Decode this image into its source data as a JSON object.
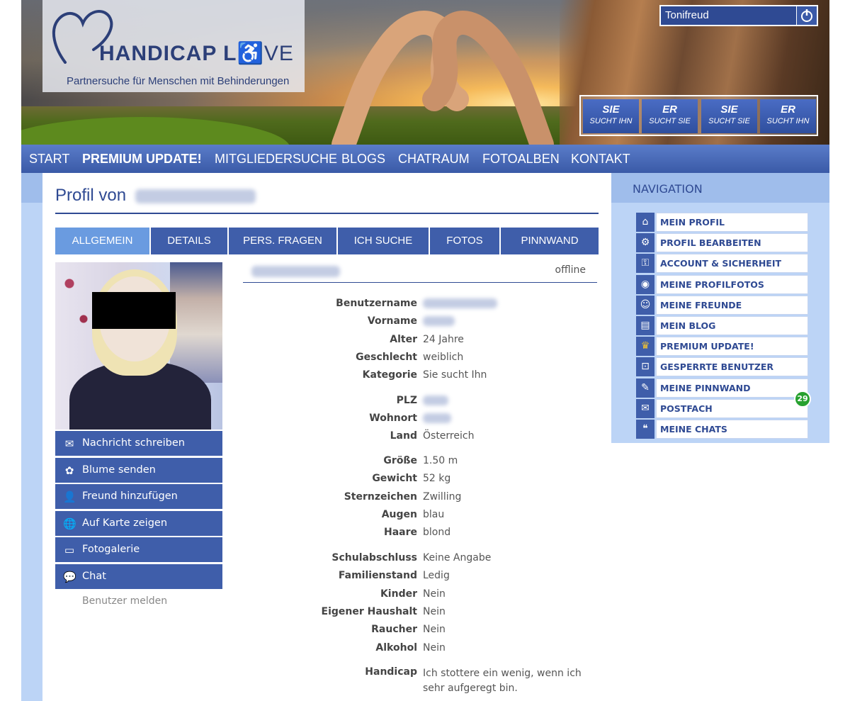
{
  "brand": {
    "name_bold": "HANDICAP L",
    "name_thin": "VE",
    "tagline": "Partnersuche für Menschen mit Behinderungen"
  },
  "user": {
    "username": "Tonifreud"
  },
  "quick_search": [
    {
      "line1": "SIE",
      "line2": "SUCHT IHN"
    },
    {
      "line1": "ER",
      "line2": "SUCHT SIE"
    },
    {
      "line1": "SIE",
      "line2": "SUCHT SIE"
    },
    {
      "line1": "ER",
      "line2": "SUCHT IHN"
    }
  ],
  "nav": [
    "START",
    "PREMIUM UPDATE!",
    "MITGLIEDERSUCHE",
    "BLOGS",
    "CHATRAUM",
    "FOTOALBEN",
    "KONTAKT"
  ],
  "profile": {
    "title_prefix": "Profil von",
    "status": "offline",
    "tabs": [
      "ALLGEMEIN",
      "DETAILS",
      "PERS. FRAGEN",
      "ICH SUCHE",
      "FOTOS",
      "PINNWAND"
    ],
    "actions": [
      "Nachricht schreiben",
      "Blume senden",
      "Freund hinzufügen",
      "Auf Karte zeigen",
      "Fotogalerie",
      "Chat"
    ],
    "report": "Benutzer melden",
    "fields": [
      {
        "k": "Benutzername",
        "v": ""
      },
      {
        "k": "Vorname",
        "v": ""
      },
      {
        "k": "Alter",
        "v": "24 Jahre"
      },
      {
        "k": "Geschlecht",
        "v": "weiblich"
      },
      {
        "k": "Kategorie",
        "v": "Sie sucht Ihn"
      },
      {
        "k": "PLZ",
        "v": ""
      },
      {
        "k": "Wohnort",
        "v": ""
      },
      {
        "k": "Land",
        "v": "Österreich"
      },
      {
        "k": "Größe",
        "v": "1.50 m"
      },
      {
        "k": "Gewicht",
        "v": "52 kg"
      },
      {
        "k": "Sternzeichen",
        "v": "Zwilling"
      },
      {
        "k": "Augen",
        "v": "blau"
      },
      {
        "k": "Haare",
        "v": "blond"
      },
      {
        "k": "Schulabschluss",
        "v": "Keine Angabe"
      },
      {
        "k": "Familienstand",
        "v": "Ledig"
      },
      {
        "k": "Kinder",
        "v": "Nein"
      },
      {
        "k": "Eigener Haushalt",
        "v": "Nein"
      },
      {
        "k": "Raucher",
        "v": "Nein"
      },
      {
        "k": "Alkohol",
        "v": "Nein"
      },
      {
        "k": "Handicap",
        "v": "Ich stottere ein wenig, wenn ich sehr aufgeregt bin."
      }
    ]
  },
  "sidebar": {
    "title": "NAVIGATION",
    "items": [
      "MEIN PROFIL",
      "PROFIL BEARBEITEN",
      "ACCOUNT & SICHERHEIT",
      "MEINE PROFILFOTOS",
      "MEINE FREUNDE",
      "MEIN BLOG",
      "PREMIUM UPDATE!",
      "GESPERRTE BENUTZER",
      "MEINE PINNWAND",
      "POSTFACH",
      "MEINE CHATS"
    ],
    "postfach_badge": "29"
  },
  "icons": {
    "home": "home-icon",
    "edit": "gear-edit-icon",
    "key": "key-icon",
    "camera": "camera-icon",
    "friends": "friends-icon",
    "blog": "newspaper-icon",
    "crown": "crown-icon",
    "lock": "lock-icon",
    "pin": "pushpin-icon",
    "mail": "envelope-icon",
    "chat": "chat-bubble-icon",
    "flower": "flower-icon",
    "add-user": "add-user-icon",
    "globe": "globe-icon",
    "monitor": "monitor-icon",
    "power": "power-icon"
  },
  "colors": {
    "brand_blue": "#2f4a93",
    "nav_blue": "#3f5eaa",
    "active_tab": "#6a9be0",
    "panel_light": "#bcd4f6",
    "badge_green": "#27a12f"
  }
}
